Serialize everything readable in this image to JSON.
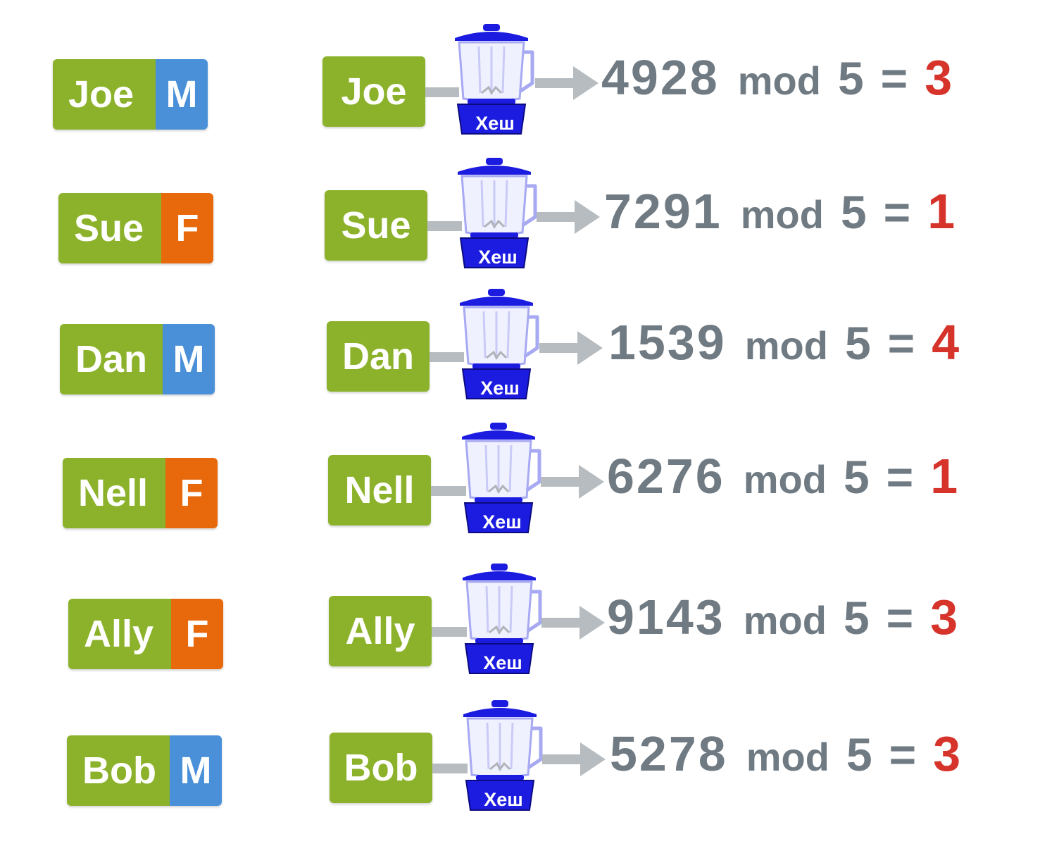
{
  "colors": {
    "name_bg": "#8cb22b",
    "gender_M": "#4a90d9",
    "gender_F": "#e8690b",
    "formula_text": "#6f7a82",
    "result_text": "#d6332b",
    "blender_blue": "#1c1ce0",
    "arrow_gray": "#b6bcbf"
  },
  "hash_label": "Хеш",
  "mod_label": "mod",
  "divisor": "5",
  "equals": "=",
  "rows": [
    {
      "name": "Joe",
      "gender": "M",
      "hash": "4928",
      "result": "3"
    },
    {
      "name": "Sue",
      "gender": "F",
      "hash": "7291",
      "result": "1"
    },
    {
      "name": "Dan",
      "gender": "M",
      "hash": "1539",
      "result": "4"
    },
    {
      "name": "Nell",
      "gender": "F",
      "hash": "6276",
      "result": "1"
    },
    {
      "name": "Ally",
      "gender": "F",
      "hash": "9143",
      "result": "3"
    },
    {
      "name": "Bob",
      "gender": "M",
      "hash": "5278",
      "result": "3"
    }
  ]
}
